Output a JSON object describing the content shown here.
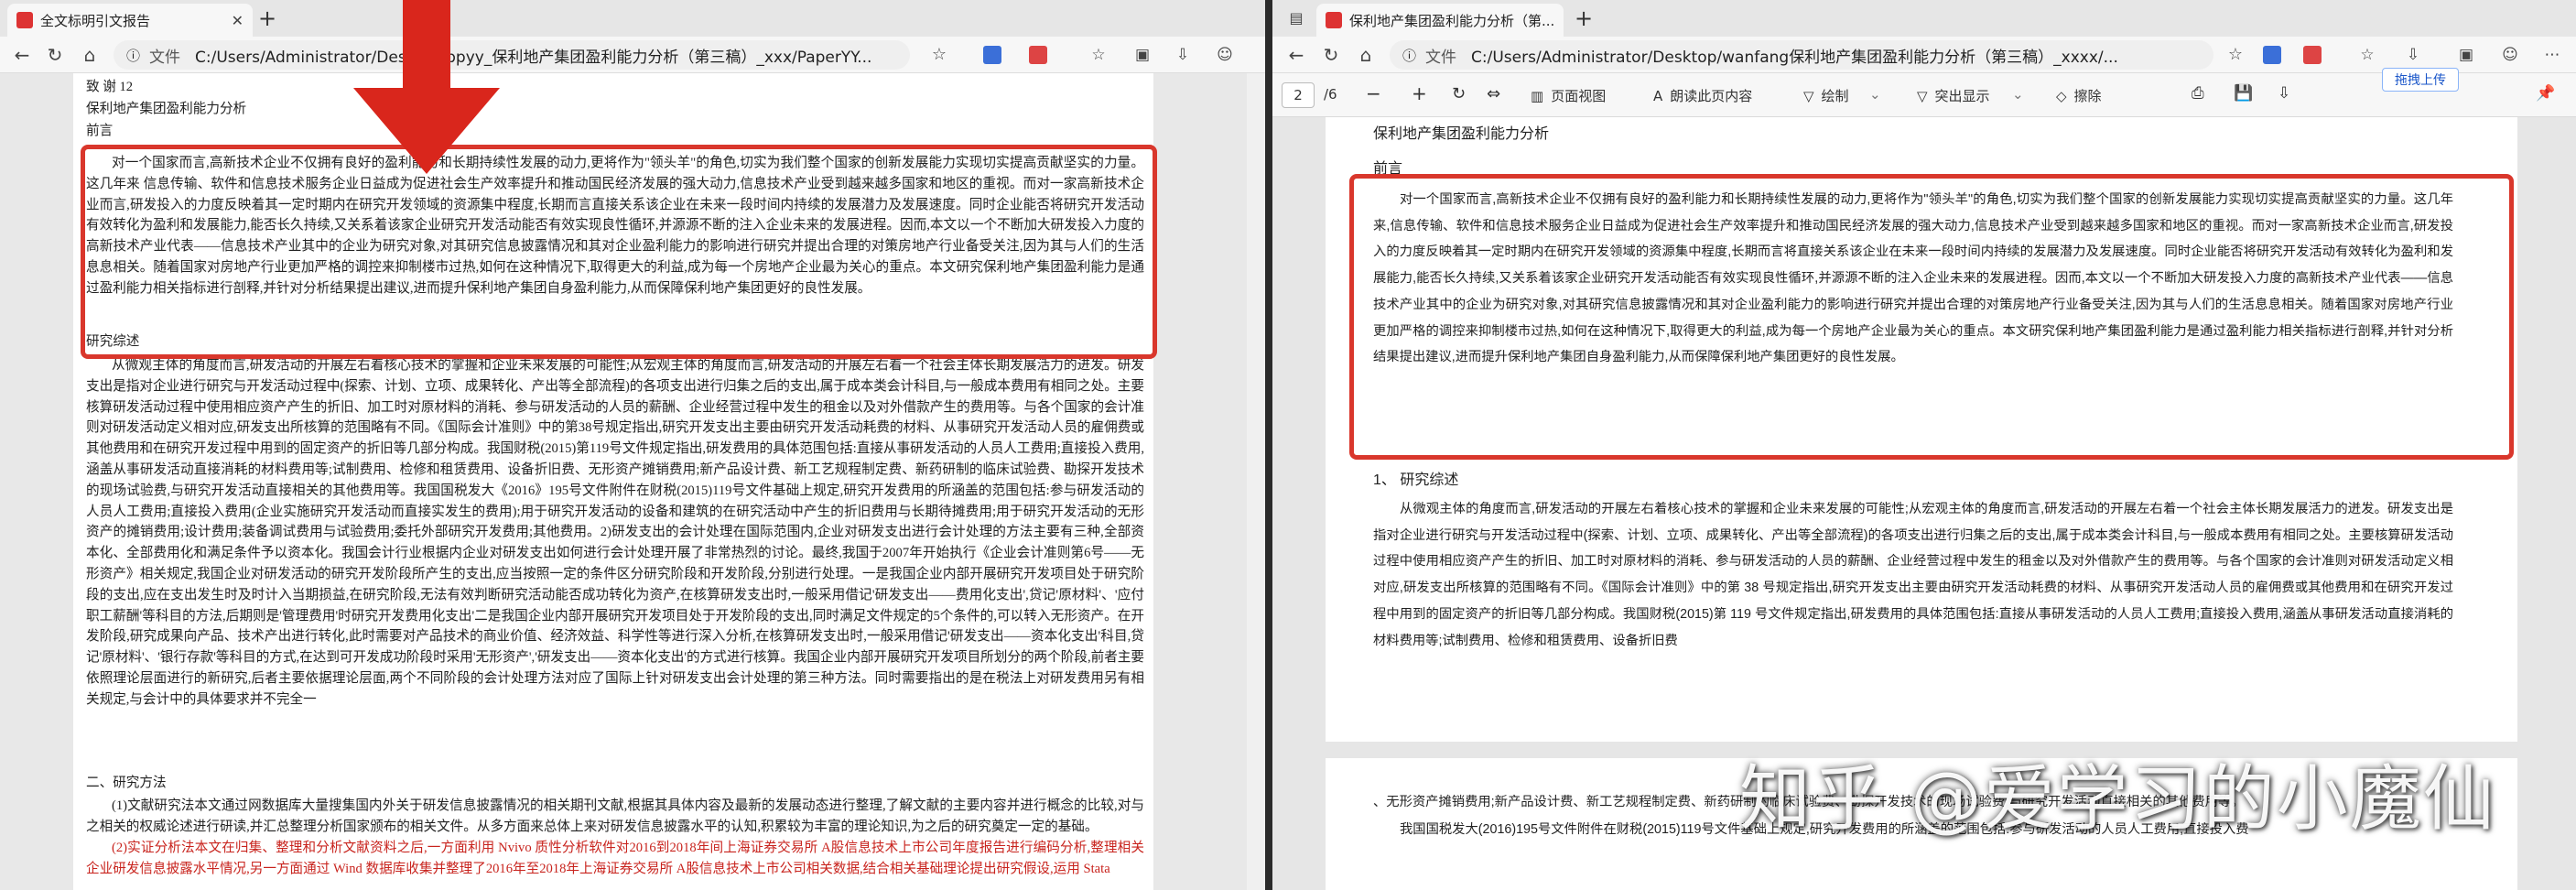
{
  "left_window": {
    "tab_title": "全文标明引文报告",
    "nav": {
      "file_label": "文件",
      "url": "C:/Users/Administrator/Desktop/ppyy_保利地产集团盈利能力分析（第三稿）_xxx/PaperYY..."
    },
    "document": {
      "heading_lines": [
        "致 谢 12",
        "保利地产集团盈利能力分析",
        "前言"
      ],
      "intro_paragraph": "对一个国家而言,高新技术企业不仅拥有良好的盈利能力和长期持续性发展的动力,更将作为\"领头羊\"的角色,切实为我们整个国家的创新发展能力实现切实提高贡献坚实的力量。这几年来 信息传输、软件和信息技术服务企业日益成为促进社会生产效率提升和推动国民经济发展的强大动力,信息技术产业受到越来越多国家和地区的重视。而对一家高新技术企业而言,研发投入的力度反映着其一定时期内在研究开发领域的资源集中程度,长期而言直接关系该企业在未来一段时间内持续的发展潜力及发展速度。同时企业能否将研究开发活动有效转化为盈利和发展能力,能否长久持续,又关系着该家企业研究开发活动能否有效实现良性循环,并源源不断的注入企业未来的发展进程。因而,本文以一个不断加大研发投入力度的高新技术产业代表——信息技术产业其中的企业为研究对象,对其研究信息披露情况和其对企业盈利能力的影响进行研究并提出合理的对策房地产行业备受关注,因为其与人们的生活息息相关。随着国家对房地产行业更加严格的调控来抑制楼市过热,如何在这种情况下,取得更大的利益,成为每一个房地产企业最为关心的重点。本文研究保利地产集团盈利能力是通过盈利能力相关指标进行剖释,并针对分析结果提出建议,进而提升保利地产集团自身盈利能力,从而保障保利地产集团更好的良性发展。",
      "section1_title": "研究综述",
      "review_paragraph": "从微观主体的角度而言,研发活动的开展左右着核心技术的掌握和企业未来发展的可能性;从宏观主体的角度而言,研发活动的开展左右着一个社会主体长期发展活力的进发。研发支出是指对企业进行研究与开发活动过程中(探索、计划、立项、成果转化、产出等全部流程)的各项支出进行归集之后的支出,属于成本类会计科目,与一般成本费用有相同之处。主要核算研发活动过程中使用相应资产产生的折旧、加工时对原材料的消耗、参与研发活动的人员的薪酬、企业经营过程中发生的租金以及对外借款产生的费用等。与各个国家的会计准则对研发活动定义相对应,研发支出所核算的范围略有不同。《国际会计准则》中的第38号规定指出,研究开发支出主要由研究开发活动耗费的材料、从事研究开发活动人员的雇佣费或其他费用和在研究开发过程中用到的固定资产的折旧等几部分构成。我国财税(2015)第119号文件规定指出,研发费用的具体范围包括:直接从事研发活动的人员人工费用;直接投入费用,涵盖从事研发活动直接消耗的材料费用等;试制费用、检修和租赁费用、设备折旧费、无形资产摊销费用;新产品设计费、新工艺规程制定费、新药研制的临床试验费、勘探开发技术的现场试验费,与研究开发活动直接相关的其他费用等。我国国税发大《2016》195号文件附件在财税(2015)119号文件基础上规定,研究开发费用的所涵盖的范围包括:参与研发活动的人员人工费用;直接投入费用(企业实施研究开发活动而直接实发生的费用);用于研究开发活动的设备和建筑的在研究活动中产生的折旧费用与长期待摊费用;用于研究开发活动的无形资产的摊销费用;设计费用;装备调试费用与试验费用;委托外部研究开发费用;其他费用。2)研发支出的会计处理在国际范围内,企业对研发支出进行会计处理的方法主要有三种,全部资本化、全部费用化和满足条件予以资本化。我国会计行业根据内企业对研发支出如何进行会计处理开展了非常热烈的讨论。最终,我国于2007年开始执行《企业会计准则第6号——无形资产》相关规定,我国企业对研发活动的研究开发阶段所产生的支出,应当按照一定的条件区分研究阶段和开发阶段,分别进行处理。一是我国企业内部开展研究开发项目处于研究阶段的支出,应在支出发生时及时计入当期损益,在研究阶段,无法有效判断研究活动能否成功转化为资产,在核算研发支出时,一般采用借记'研发支出——费用化支出',贷记'原材料'、'应付职工薪酬'等科目的方法,后期则是'管理费用'时研究开发费用化支出'二是我国企业内部开展研究开发项目处于开发阶段的支出,同时满足文件规定的5个条件的,可以转入无形资产。在开发阶段,研究成果向产品、技术产出进行转化,此时需要对产品技术的商业价值、经济效益、科学性等进行深入分析,在核算研发支出时,一般采用借记'研发支出——资本化支出'科目,贷记'原材料'、'银行存款'等科目的方式,在达到可开发成功阶段时采用'无形资产','研发支出——资本化支出'的方式进行核算。我国企业内部开展研究开发项目所划分的两个阶段,前者主要依照理论层面进行的新研究,后者主要依据理论层面,两个不同阶段的会计处理方法对应了国际上针对研发支出会计处理的第三种方法。同时需要指出的是在税法上对研发费用另有相关规定,与会计中的具体要求并不完全一",
      "section2_title": "二、研究方法",
      "method_paragraph": "(1)文献研究法本文通过网数据库大量搜集国内外关于研发信息披露情况的相关期刊文献,根据其具体内容及最新的发展动态进行整理,了解文献的主要内容并进行概念的比较,对与之相关的权威论述进行研读,并汇总整理分析国家颁布的相关文件。从多方面来总体上来对研发信息披露水平的认知,积累较为丰富的理论知识,为之后的研究奠定一定的基础。",
      "method2_paragraph": "(2)实证分析法本文在归集、整理和分析文献资料之后,一方面利用 Nvivo 质性分析软件对2016到2018年间上海证券交易所 A股信息技术上市公司年度报告进行编码分析,整理相关企业研发信息披露水平情况,另一方面通过 Wind 数据库收集并整理了2016年至2018年上海证券交易所 A股信息技术上市公司相关数据,结合相关基础理论提出研究假设,运用 Stata"
    }
  },
  "right_window": {
    "tab_title": "保利地产集团盈利能力分析（第...",
    "nav": {
      "file_label": "文件",
      "url": "C:/Users/Administrator/Desktop/wanfang保利地产集团盈利能力分析（第三稿）_xxxx/..."
    },
    "pdf_toolbar": {
      "page_current": "2",
      "page_total": "/6",
      "zoom_out": "−",
      "zoom_in": "+",
      "page_view": "页面视图",
      "read_aloud": "朗读此页内容",
      "draw": "绘制",
      "highlight": "突出显示",
      "erase": "擦除",
      "tooltip": "拖拽上传"
    },
    "document": {
      "title": "保利地产集团盈利能力分析",
      "preface": "前言",
      "intro_paragraph": "对一个国家而言,高新技术企业不仅拥有良好的盈利能力和长期持续性发展的动力,更将作为\"领头羊\"的角色,切实为我们整个国家的创新发展能力实现切实提高贡献坚实的力量。这几年来,信息传输、软件和信息技术服务企业日益成为促进社会生产效率提升和推动国民经济发展的强大动力,信息技术产业受到越来越多国家和地区的重视。而对一家高新技术企业而言,研发投入的力度反映着其一定时期内在研究开发领域的资源集中程度,长期而言将直接关系该企业在未来一段时间内持续的发展潜力及发展速度。同时企业能否将研究开发活动有效转化为盈利和发展能力,能否长久持续,又关系着该家企业研究开发活动能否有效实现良性循环,并源源不断的注入企业未来的发展进程。因而,本文以一个不断加大研发投入力度的高新技术产业代表——信息技术产业其中的企业为研究对象,对其研究信息披露情况和其对企业盈利能力的影响进行研究并提出合理的对策房地产行业备受关注,因为其与人们的生活息息相关。随着国家对房地产行业更加严格的调控来抑制楼市过热,如何在这种情况下,取得更大的利益,成为每一个房地产企业最为关心的重点。本文研究保利地产集团盈利能力是通过盈利能力相关指标进行剖释,并针对分析结果提出建议,进而提升保利地产集团自身盈利能力,从而保障保利地产集团更好的良性发展。",
      "section1_title": "1、 研究综述",
      "review_paragraph": "从微观主体的角度而言,研发活动的开展左右着核心技术的掌握和企业未来发展的可能性;从宏观主体的角度而言,研发活动的开展左右着一个社会主体长期发展活力的迸发。研发支出是指对企业进行研究与开发活动过程中(探索、计划、立项、成果转化、产出等全部流程)的各项支出进行归集之后的支出,属于成本类会计科目,与一般成本费用有相同之处。主要核算研发活动过程中使用相应资产产生的折旧、加工时对原材料的消耗、参与研发活动的人员的薪酬、企业经营过程中发生的租金以及对外借款产生的费用等。与各个国家的会计准则对研发活动定义相对应,研发支出所核算的范围略有不同。《国际会计准则》中的第 38 号规定指出,研究开发支出主要由研究开发活动耗费的材料、从事研究开发活动人员的雇佣费或其他费用和在研究开发过程中用到的固定资产的折旧等几部分构成。我国财税(2015)第 119 号文件规定指出,研发费用的具体范围包括:直接从事研发活动的人员人工费用;直接投入费用,涵盖从事研发活动直接消耗的材料费用等;试制费用、检修和租赁费用、设备折旧费",
      "page2_line1": "、无形资产摊销费用;新产品设计费、新工艺规程制定费、新药研制的临床试验费、勘探开发技术的现场试验费;与研究开发活动直接相关的其他费用等。",
      "page2_line2": "我国国税发大(2016)195号文件附件在财税(2015)119号文件基础上规定,研究开发费用的所涵盖的范围包括:参与研发活动的人员人工费用;直接投入费"
    }
  },
  "watermark": "知乎 @爱学习的小魔仙"
}
